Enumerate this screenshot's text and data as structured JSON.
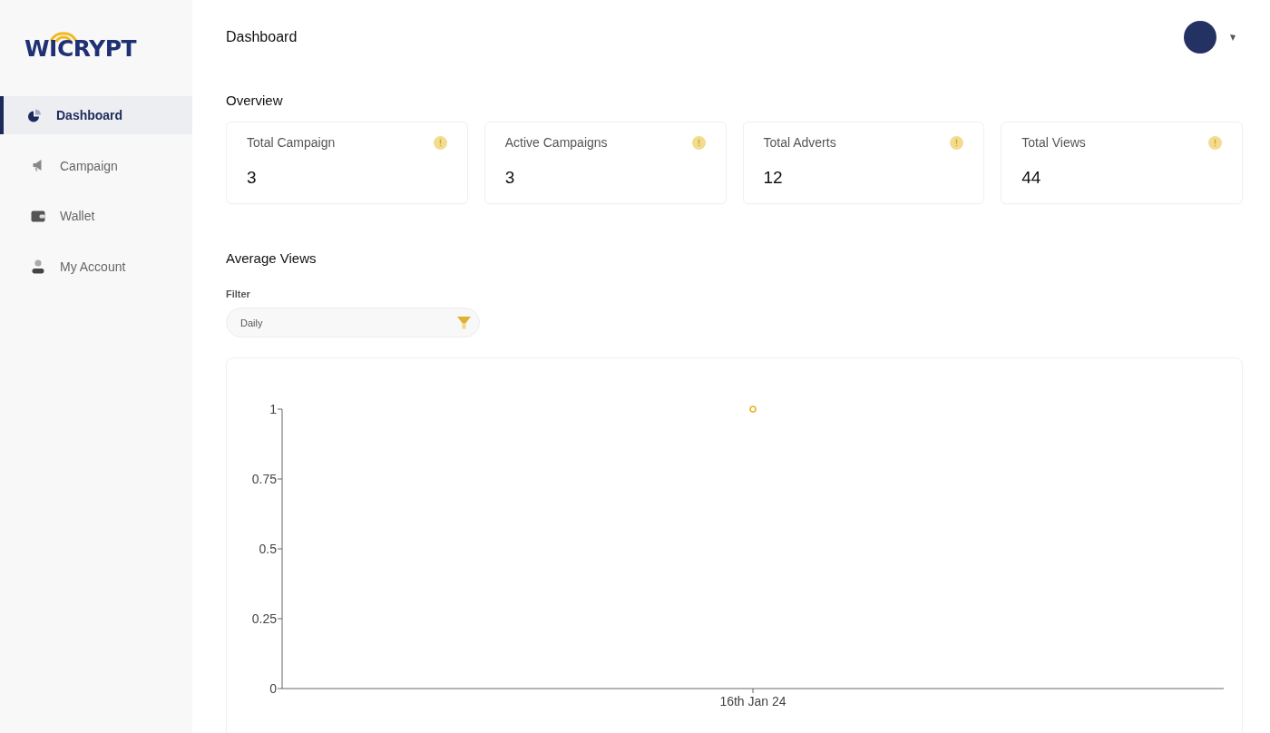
{
  "logo": {
    "text": "WICRYPT"
  },
  "sidebar": {
    "items": [
      {
        "label": "Dashboard",
        "selected": true
      },
      {
        "label": "Campaign",
        "selected": false
      },
      {
        "label": "Wallet",
        "selected": false
      },
      {
        "label": "My Account",
        "selected": false
      }
    ]
  },
  "header": {
    "title": "Dashboard"
  },
  "overview": {
    "title": "Overview",
    "cards": [
      {
        "label": "Total Campaign",
        "value": "3"
      },
      {
        "label": "Active Campaigns",
        "value": "3"
      },
      {
        "label": "Total Adverts",
        "value": "12"
      },
      {
        "label": "Total Views",
        "value": "44"
      }
    ]
  },
  "average_views": {
    "title": "Average Views",
    "filter": {
      "label": "Filter",
      "value": "Daily"
    },
    "chart_data": {
      "type": "scatter",
      "categories": [
        "16th Jan 24"
      ],
      "series": [
        {
          "color": "#e6b422",
          "values": [
            1
          ]
        }
      ],
      "ylim": [
        0,
        1
      ],
      "yticks": [
        0,
        0.25,
        0.5,
        0.75,
        1
      ]
    }
  }
}
